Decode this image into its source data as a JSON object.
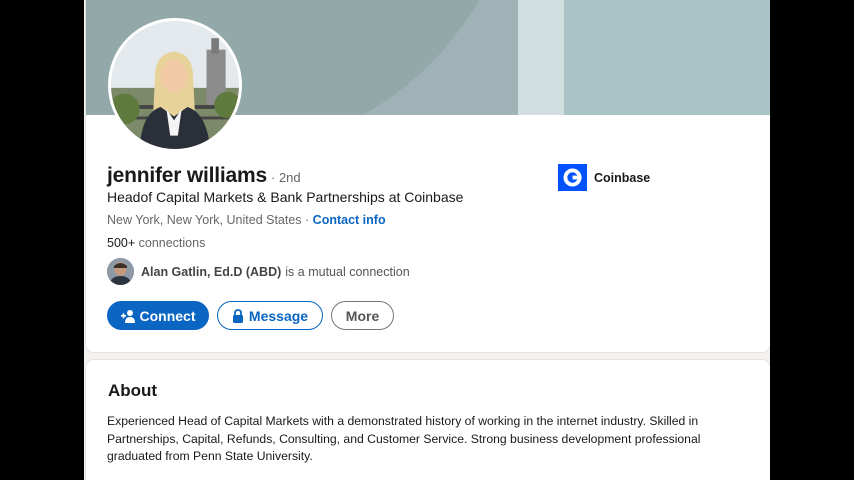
{
  "profile": {
    "name": "jennifer williams",
    "degree": "· 2nd",
    "headline": "Headof Capital Markets & Bank Partnerships at Coinbase",
    "location": "New York, New York, United States",
    "location_separator": " · ",
    "contact_info_label": "Contact info",
    "connections_count": "500+",
    "connections_label": " connections",
    "mutual_connection_name": "Alan Gatlin, Ed.D (ABD)",
    "mutual_connection_suffix": "is a mutual connection",
    "company": "Coinbase"
  },
  "actions": {
    "connect_label": "Connect",
    "message_label": "Message",
    "more_label": "More"
  },
  "about": {
    "title": "About",
    "text": "Experienced Head of Capital Markets with a demonstrated history of working in the internet industry. Skilled in Partnerships, Capital, Refunds, Consulting, and Customer Service. Strong business development professional graduated from Penn State University."
  },
  "colors": {
    "accent": "#0a66c2",
    "coinbase_blue": "#0052ff",
    "banner": "#9fb3b6"
  },
  "icons": {
    "connect": "add-person-icon",
    "message": "lock-icon",
    "company": "coinbase-logo-icon"
  }
}
